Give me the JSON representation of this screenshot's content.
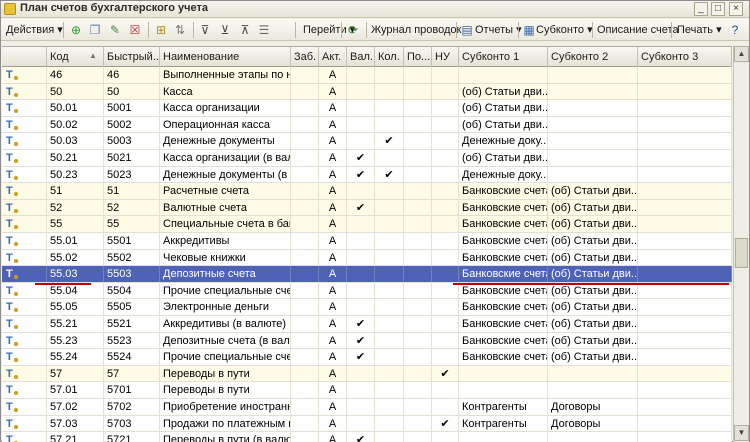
{
  "window": {
    "title": "План счетов бухгалтерского учета"
  },
  "toolbar": {
    "actions_label": "Действия",
    "goto_label": "Перейти",
    "journal_label": "Журнал проводок",
    "reports_label": "Отчеты",
    "subconto_label": "Субконто",
    "account_desc_label": "Описание счета",
    "print_label": "Печать"
  },
  "columns": [
    "Код",
    "Быстрый...",
    "Наименование",
    "Заб.",
    "Акт.",
    "Вал.",
    "Кол.",
    "По...",
    "НУ",
    "Субконто 1",
    "Субконто 2",
    "Субконто 3"
  ],
  "rows": [
    {
      "code": "46",
      "quick": "46",
      "name": "Выполненные этапы по н...",
      "act": "А",
      "val": "",
      "kol": "",
      "nu": "",
      "s1": "",
      "s2": ""
    },
    {
      "code": "50",
      "quick": "50",
      "name": "Касса",
      "act": "А",
      "val": "",
      "kol": "",
      "nu": "",
      "s1": "(об) Статьи дви...",
      "s2": ""
    },
    {
      "code": "50.01",
      "quick": "5001",
      "name": "Касса организации",
      "act": "А",
      "val": "",
      "kol": "",
      "nu": "",
      "s1": "(об) Статьи дви...",
      "s2": ""
    },
    {
      "code": "50.02",
      "quick": "5002",
      "name": "Операционная касса",
      "act": "А",
      "val": "",
      "kol": "",
      "nu": "",
      "s1": "(об) Статьи дви...",
      "s2": ""
    },
    {
      "code": "50.03",
      "quick": "5003",
      "name": "Денежные документы",
      "act": "А",
      "val": "",
      "kol": "✔",
      "nu": "",
      "s1": "Денежные доку...",
      "s2": ""
    },
    {
      "code": "50.21",
      "quick": "5021",
      "name": "Касса организации (в валю...",
      "act": "А",
      "val": "✔",
      "kol": "",
      "nu": "",
      "s1": "(об) Статьи дви...",
      "s2": ""
    },
    {
      "code": "50.23",
      "quick": "5023",
      "name": "Денежные документы (в ...",
      "act": "А",
      "val": "✔",
      "kol": "✔",
      "nu": "",
      "s1": "Денежные доку...",
      "s2": ""
    },
    {
      "code": "51",
      "quick": "51",
      "name": "Расчетные счета",
      "act": "А",
      "val": "",
      "kol": "",
      "nu": "",
      "s1": "Банковские счета",
      "s2": "(об) Статьи дви..."
    },
    {
      "code": "52",
      "quick": "52",
      "name": "Валютные счета",
      "act": "А",
      "val": "✔",
      "kol": "",
      "nu": "",
      "s1": "Банковские счета",
      "s2": "(об) Статьи дви..."
    },
    {
      "code": "55",
      "quick": "55",
      "name": "Специальные счета в бан...",
      "act": "А",
      "val": "",
      "kol": "",
      "nu": "",
      "s1": "Банковские счета",
      "s2": "(об) Статьи дви..."
    },
    {
      "code": "55.01",
      "quick": "5501",
      "name": "Аккредитивы",
      "act": "А",
      "val": "",
      "kol": "",
      "nu": "",
      "s1": "Банковские счета",
      "s2": "(об) Статьи дви..."
    },
    {
      "code": "55.02",
      "quick": "5502",
      "name": "Чековые книжки",
      "act": "А",
      "val": "",
      "kol": "",
      "nu": "",
      "s1": "Банковские счета",
      "s2": "(об) Статьи дви..."
    },
    {
      "code": "55.03",
      "quick": "5503",
      "name": "Депозитные счета",
      "act": "А",
      "val": "",
      "kol": "",
      "nu": "",
      "s1": "Банковские счета",
      "s2": "(об) Статьи дви..."
    },
    {
      "code": "55.04",
      "quick": "5504",
      "name": "Прочие специальные счета",
      "act": "А",
      "val": "",
      "kol": "",
      "nu": "",
      "s1": "Банковские счета",
      "s2": "(об) Статьи дви..."
    },
    {
      "code": "55.05",
      "quick": "5505",
      "name": "Электронные деньги",
      "act": "А",
      "val": "",
      "kol": "",
      "nu": "",
      "s1": "Банковские счета",
      "s2": "(об) Статьи дви..."
    },
    {
      "code": "55.21",
      "quick": "5521",
      "name": "Аккредитивы (в валюте)",
      "act": "А",
      "val": "✔",
      "kol": "",
      "nu": "",
      "s1": "Банковские счета",
      "s2": "(об) Статьи дви..."
    },
    {
      "code": "55.23",
      "quick": "5523",
      "name": "Депозитные счета (в валю...",
      "act": "А",
      "val": "✔",
      "kol": "",
      "nu": "",
      "s1": "Банковские счета",
      "s2": "(об) Статьи дви..."
    },
    {
      "code": "55.24",
      "quick": "5524",
      "name": "Прочие специальные счет...",
      "act": "А",
      "val": "✔",
      "kol": "",
      "nu": "",
      "s1": "Банковские счета",
      "s2": "(об) Статьи дви..."
    },
    {
      "code": "57",
      "quick": "57",
      "name": "Переводы в пути",
      "act": "А",
      "val": "",
      "kol": "",
      "nu": "✔",
      "s1": "",
      "s2": ""
    },
    {
      "code": "57.01",
      "quick": "5701",
      "name": "Переводы в пути",
      "act": "А",
      "val": "",
      "kol": "",
      "nu": "",
      "s1": "",
      "s2": ""
    },
    {
      "code": "57.02",
      "quick": "5702",
      "name": "Приобретение иностранн...",
      "act": "А",
      "val": "",
      "kol": "",
      "nu": "",
      "s1": "Контрагенты",
      "s2": "Договоры"
    },
    {
      "code": "57.03",
      "quick": "5703",
      "name": "Продажи по платежным к...",
      "act": "А",
      "val": "",
      "kol": "",
      "nu": "✔",
      "s1": "Контрагенты",
      "s2": "Договоры"
    },
    {
      "code": "57.21",
      "quick": "5721",
      "name": "Переводы в пути (в валюте)",
      "act": "А",
      "val": "✔",
      "kol": "",
      "nu": "",
      "s1": "",
      "s2": ""
    }
  ],
  "selected_code": "55.03",
  "colors": {
    "selection": "#4e62b7",
    "highlight_line": "#c00000",
    "alt_row": "#fefbe6"
  },
  "icons": [
    "account-icon"
  ]
}
